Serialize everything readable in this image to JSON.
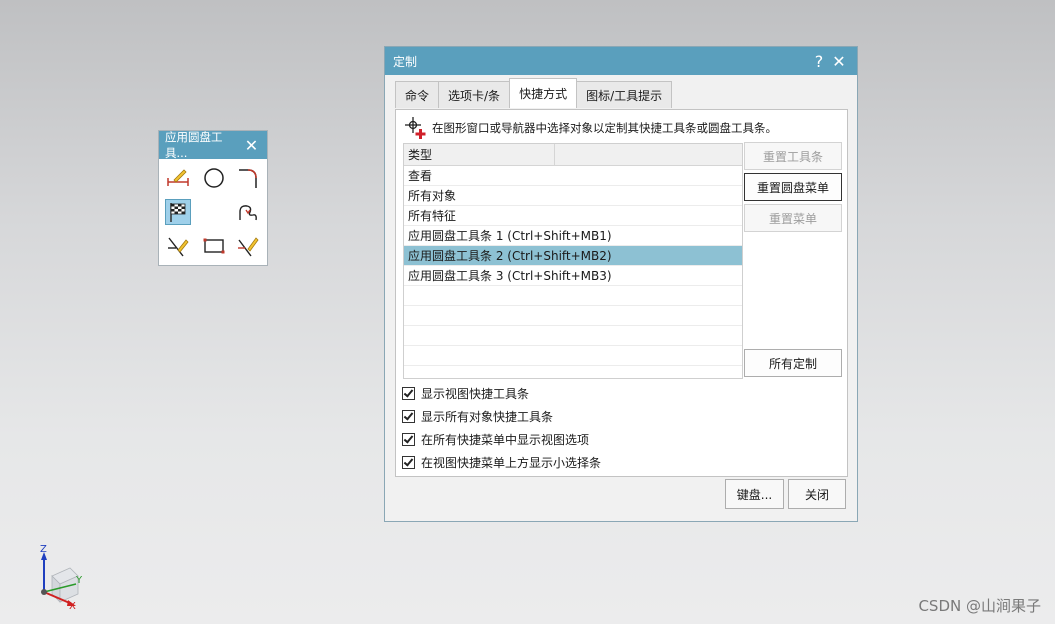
{
  "radial_toolbar": {
    "title": "应用圆盘工具...",
    "close": "✕",
    "icons": [
      "line-edit-icon",
      "circle-icon",
      "fillet-icon",
      "finish-sketch-icon",
      "curve-loop-icon",
      "trim-curve-icon",
      "rectangle-icon",
      "extend-curve-icon"
    ]
  },
  "dialog": {
    "title": "定制",
    "help": "?",
    "close": "✕",
    "tabs": [
      "命令",
      "选项卡/条",
      "快捷方式",
      "图标/工具提示"
    ],
    "active_tab": 2,
    "instruction": "在图形窗口或导航器中选择对象以定制其快捷工具条或圆盘工具条。",
    "table": {
      "header": "类型",
      "rows": [
        "查看",
        "所有对象",
        "所有特征",
        "应用圆盘工具条 1 (Ctrl+Shift+MB1)",
        "应用圆盘工具条 2 (Ctrl+Shift+MB2)",
        "应用圆盘工具条 3 (Ctrl+Shift+MB3)"
      ],
      "selected_index": 4
    },
    "buttons": {
      "reset_toolbar": "重置工具条",
      "reset_radial": "重置圆盘菜单",
      "reset_menu": "重置菜单",
      "all_custom": "所有定制"
    },
    "checkboxes": [
      "显示视图快捷工具条",
      "显示所有对象快捷工具条",
      "在所有快捷菜单中显示视图选项",
      "在视图快捷菜单上方显示小选择条"
    ],
    "footer": {
      "keyboard": "键盘...",
      "close": "关闭"
    }
  },
  "triad": {
    "x": "X",
    "y": "Y",
    "z": "Z"
  },
  "watermark": "CSDN @山涧果子",
  "colors": {
    "title_bar": "#5a9fbd",
    "selected_row": "#8dc1d3"
  }
}
